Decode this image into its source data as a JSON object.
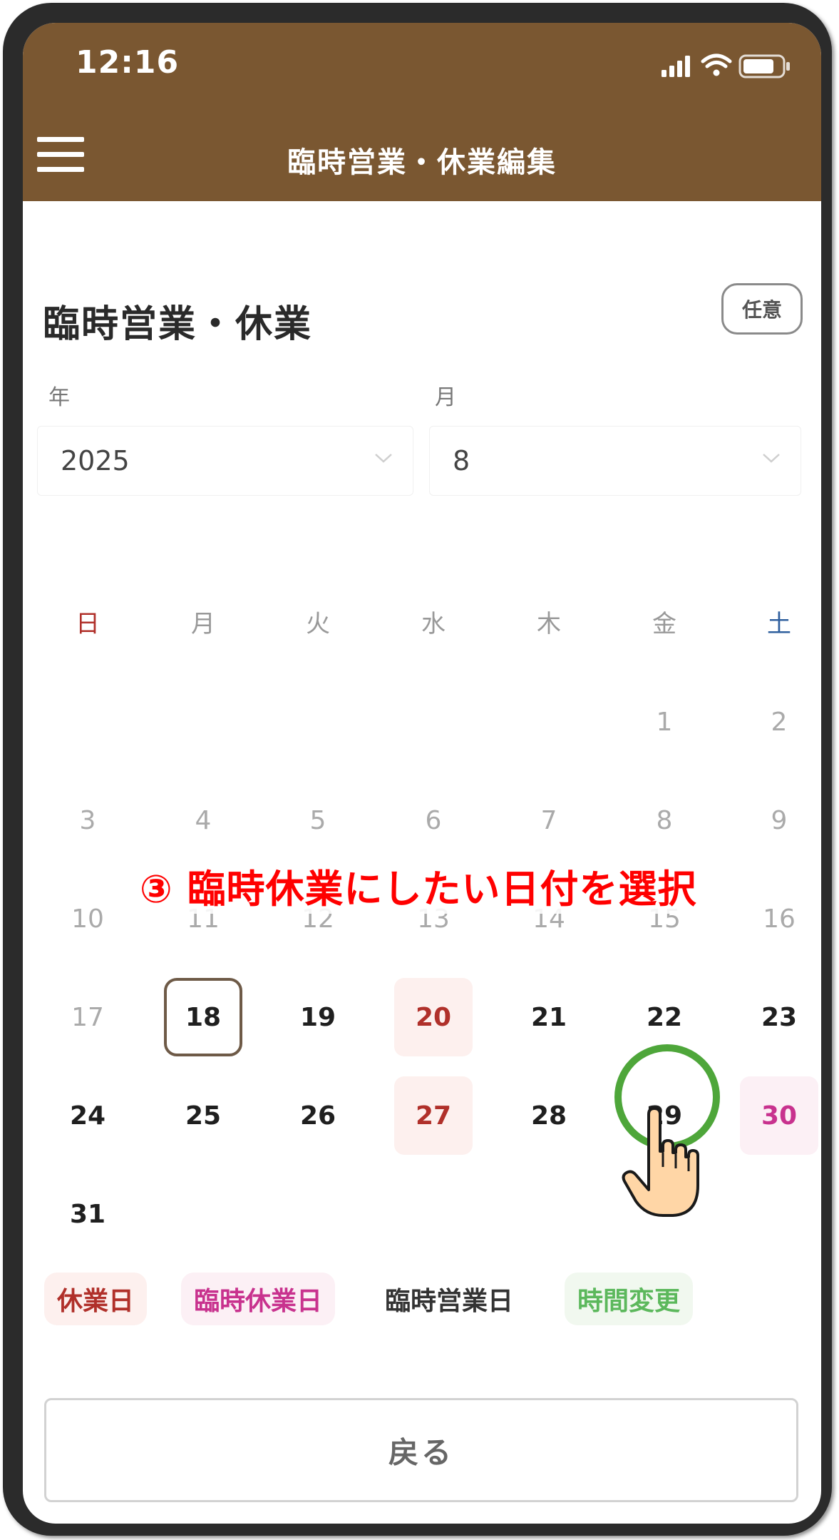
{
  "status_bar": {
    "time": "12:16"
  },
  "header": {
    "title": "臨時営業・休業編集"
  },
  "section": {
    "title": "臨時営業・休業",
    "badge": "任意"
  },
  "form": {
    "year": {
      "label": "年",
      "value": "2025"
    },
    "month": {
      "label": "月",
      "value": "8"
    }
  },
  "calendar": {
    "weekdays": [
      "日",
      "月",
      "火",
      "水",
      "木",
      "金",
      "土"
    ],
    "weekday_colors": {
      "sunday": "#b0302a",
      "saturday": "#2f5f9e"
    },
    "days": {
      "d1": "1",
      "d2": "2",
      "d3": "3",
      "d4": "4",
      "d5": "5",
      "d6": "6",
      "d7": "7",
      "d8": "8",
      "d9": "9",
      "d10": "10",
      "d11": "11",
      "d12": "12",
      "d13": "13",
      "d14": "14",
      "d15": "15",
      "d16": "16",
      "d17": "17",
      "d18": "18",
      "d19": "19",
      "d20": "20",
      "d21": "21",
      "d22": "22",
      "d23": "23",
      "d24": "24",
      "d25": "25",
      "d26": "26",
      "d27": "27",
      "d28": "28",
      "d29": "29",
      "d30": "30",
      "d31": "31"
    },
    "today": "18",
    "holidays": [
      "20",
      "27"
    ],
    "temporary_holidays": [
      "30"
    ]
  },
  "instruction": "③ 臨時休業にしたい日付を選択",
  "legend": {
    "holiday": "休業日",
    "temp_holiday": "臨時休業日",
    "temp_open": "臨時営業日",
    "time_change": "時間変更"
  },
  "legend_colors": {
    "holiday": "#b0302a",
    "temp_holiday": "#c8328e",
    "temp_open": "#333333",
    "time_change": "#5cb85c"
  },
  "back_button": {
    "label": "戻る"
  },
  "annotation": {
    "ring_color": "#4ea63a",
    "target_day": "29"
  }
}
